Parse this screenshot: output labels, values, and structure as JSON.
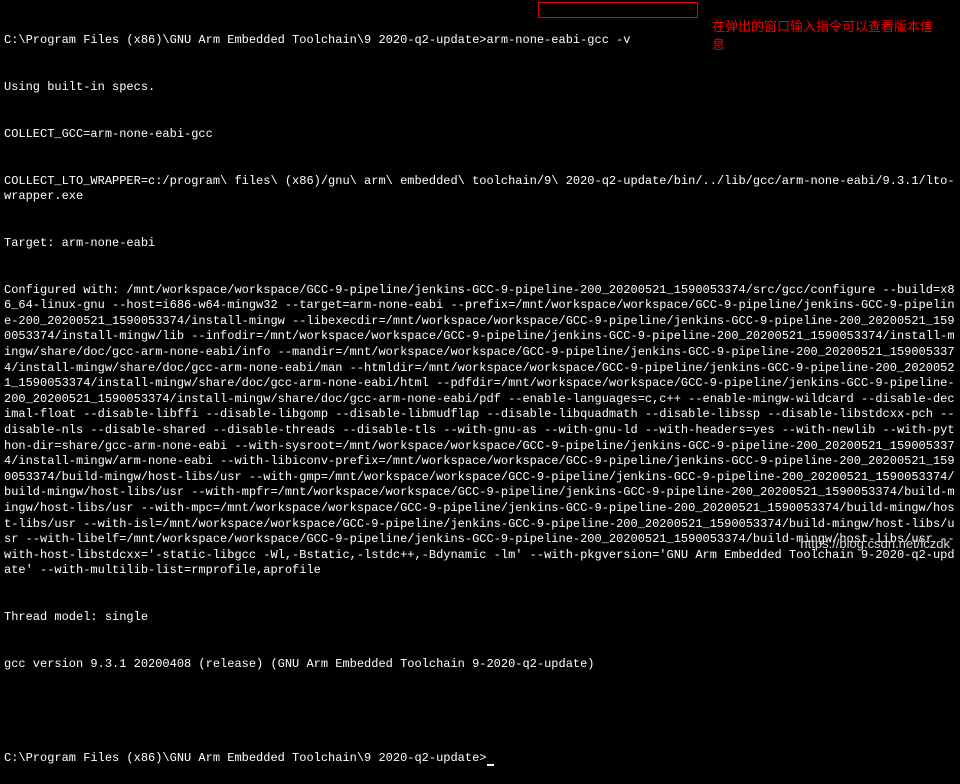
{
  "prompt1_path": "C:\\Program Files (x86)\\GNU Arm Embedded Toolchain\\9 2020-q2-update>",
  "prompt1_cmd": "arm-none-eabi-gcc -v",
  "line_specs": "Using built-in specs.",
  "line_collect_gcc": "COLLECT_GCC=arm-none-eabi-gcc",
  "line_collect_lto": "COLLECT_LTO_WRAPPER=c:/program\\ files\\ (x86)/gnu\\ arm\\ embedded\\ toolchain/9\\ 2020-q2-update/bin/../lib/gcc/arm-none-eabi/9.3.1/lto-wrapper.exe",
  "line_target": "Target: arm-none-eabi",
  "line_configured": "Configured with: /mnt/workspace/workspace/GCC-9-pipeline/jenkins-GCC-9-pipeline-200_20200521_1590053374/src/gcc/configure --build=x86_64-linux-gnu --host=i686-w64-mingw32 --target=arm-none-eabi --prefix=/mnt/workspace/workspace/GCC-9-pipeline/jenkins-GCC-9-pipeline-200_20200521_1590053374/install-mingw --libexecdir=/mnt/workspace/workspace/GCC-9-pipeline/jenkins-GCC-9-pipeline-200_20200521_1590053374/install-mingw/lib --infodir=/mnt/workspace/workspace/GCC-9-pipeline/jenkins-GCC-9-pipeline-200_20200521_1590053374/install-mingw/share/doc/gcc-arm-none-eabi/info --mandir=/mnt/workspace/workspace/GCC-9-pipeline/jenkins-GCC-9-pipeline-200_20200521_1590053374/install-mingw/share/doc/gcc-arm-none-eabi/man --htmldir=/mnt/workspace/workspace/GCC-9-pipeline/jenkins-GCC-9-pipeline-200_20200521_1590053374/install-mingw/share/doc/gcc-arm-none-eabi/html --pdfdir=/mnt/workspace/workspace/GCC-9-pipeline/jenkins-GCC-9-pipeline-200_20200521_1590053374/install-mingw/share/doc/gcc-arm-none-eabi/pdf --enable-languages=c,c++ --enable-mingw-wildcard --disable-decimal-float --disable-libffi --disable-libgomp --disable-libmudflap --disable-libquadmath --disable-libssp --disable-libstdcxx-pch --disable-nls --disable-shared --disable-threads --disable-tls --with-gnu-as --with-gnu-ld --with-headers=yes --with-newlib --with-python-dir=share/gcc-arm-none-eabi --with-sysroot=/mnt/workspace/workspace/GCC-9-pipeline/jenkins-GCC-9-pipeline-200_20200521_1590053374/install-mingw/arm-none-eabi --with-libiconv-prefix=/mnt/workspace/workspace/GCC-9-pipeline/jenkins-GCC-9-pipeline-200_20200521_1590053374/build-mingw/host-libs/usr --with-gmp=/mnt/workspace/workspace/GCC-9-pipeline/jenkins-GCC-9-pipeline-200_20200521_1590053374/build-mingw/host-libs/usr --with-mpfr=/mnt/workspace/workspace/GCC-9-pipeline/jenkins-GCC-9-pipeline-200_20200521_1590053374/build-mingw/host-libs/usr --with-mpc=/mnt/workspace/workspace/GCC-9-pipeline/jenkins-GCC-9-pipeline-200_20200521_1590053374/build-mingw/host-libs/usr --with-isl=/mnt/workspace/workspace/GCC-9-pipeline/jenkins-GCC-9-pipeline-200_20200521_1590053374/build-mingw/host-libs/usr --with-libelf=/mnt/workspace/workspace/GCC-9-pipeline/jenkins-GCC-9-pipeline-200_20200521_1590053374/build-mingw/host-libs/usr --with-host-libstdcxx='-static-libgcc -Wl,-Bstatic,-lstdc++,-Bdynamic -lm' --with-pkgversion='GNU Arm Embedded Toolchain 9-2020-q2-update' --with-multilib-list=rmprofile,aprofile",
  "line_thread": "Thread model: single",
  "line_version": "gcc version 9.3.1 20200408 (release) (GNU Arm Embedded Toolchain 9-2020-q2-update)",
  "blank": " ",
  "prompt2": "C:\\Program Files (x86)\\GNU Arm Embedded Toolchain\\9 2020-q2-update>",
  "annotation_text": "在弹出的窗口输入指令可以查看版本信息",
  "watermark_text": "https://blog.csdn.net/lczdk"
}
